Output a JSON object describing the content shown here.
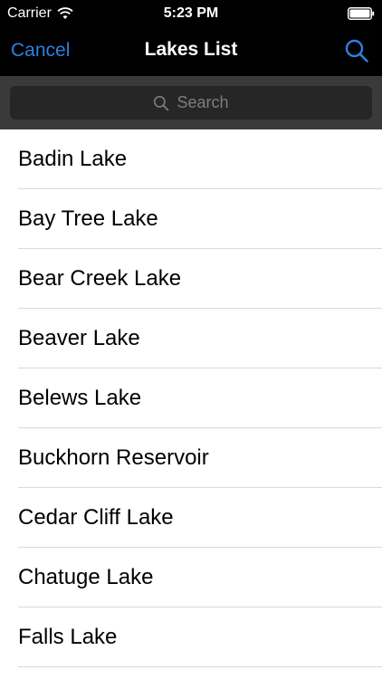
{
  "status_bar": {
    "carrier": "Carrier",
    "time": "5:23 PM"
  },
  "nav": {
    "cancel_label": "Cancel",
    "title": "Lakes List",
    "search_icon": "search-icon"
  },
  "search": {
    "placeholder": "Search"
  },
  "lakes": [
    "Badin Lake",
    "Bay Tree Lake",
    "Bear Creek Lake",
    "Beaver Lake",
    "Belews Lake",
    "Buckhorn Reservoir",
    "Cedar Cliff Lake",
    "Chatuge Lake",
    "Falls Lake"
  ],
  "colors": {
    "accent": "#2f7fe0",
    "nav_background": "#000000",
    "search_area": "#3a3a3a",
    "list_background": "#ffffff"
  }
}
